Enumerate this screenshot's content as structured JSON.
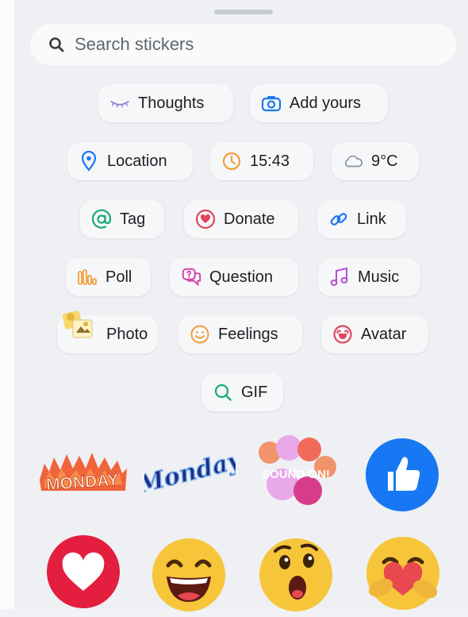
{
  "search": {
    "placeholder": "Search stickers"
  },
  "stickers": {
    "thoughts": "Thoughts",
    "add_yours": "Add yours",
    "location": "Location",
    "time": "15:43",
    "weather": "9°C",
    "tag": "Tag",
    "donate": "Donate",
    "link": "Link",
    "poll": "Poll",
    "question": "Question",
    "music": "Music",
    "photo": "Photo",
    "feelings": "Feelings",
    "avatar": "Avatar",
    "gif": "GIF"
  },
  "gallery": {
    "monday_fire": "MONDAY",
    "monday_script": "Monday",
    "sound_on": "SOUND ON!"
  },
  "colors": {
    "background": "#eef0f3",
    "pill": "#f6f7f9",
    "like_blue": "#1877f2",
    "heart_red": "#e41e3f",
    "emoji_yellow": "#f7c53a"
  }
}
